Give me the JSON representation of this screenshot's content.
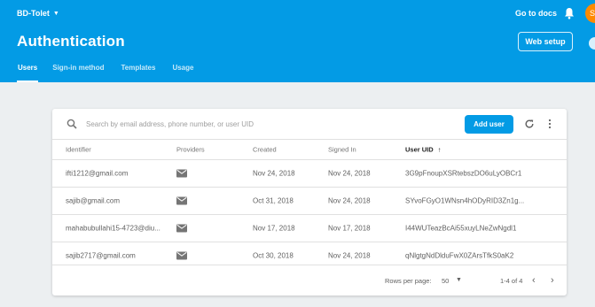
{
  "header": {
    "project_name": "BD-Tolet",
    "go_to_docs": "Go to docs",
    "avatar_initial": "S",
    "title": "Authentication",
    "web_setup": "Web setup",
    "tabs": [
      {
        "label": "Users",
        "active": true
      },
      {
        "label": "Sign-in method",
        "active": false
      },
      {
        "label": "Templates",
        "active": false
      },
      {
        "label": "Usage",
        "active": false
      }
    ]
  },
  "search": {
    "placeholder": "Search by email address, phone number, or user UID"
  },
  "toolbar": {
    "add_user_label": "Add user"
  },
  "table": {
    "headers": {
      "identifier": "Identifier",
      "providers": "Providers",
      "created": "Created",
      "signed_in": "Signed In",
      "user_uid": "User UID",
      "sort_arrow": "↑"
    },
    "rows": [
      {
        "identifier": "ifti1212@gmail.com",
        "provider_icon": "mail-icon",
        "created": "Nov 24, 2018",
        "signed_in": "Nov 24, 2018",
        "uid": "3G9pFnoupXSRtebszDO6uLyOBCr1"
      },
      {
        "identifier": "sajib@gmail.com",
        "provider_icon": "mail-icon",
        "created": "Oct 31, 2018",
        "signed_in": "Nov 24, 2018",
        "uid": "SYvoFGyO1WNsn4hODyRID3Zn1g..."
      },
      {
        "identifier": "mahabubullahi15-4723@diu...",
        "provider_icon": "mail-icon",
        "created": "Nov 17, 2018",
        "signed_in": "Nov 17, 2018",
        "uid": "I44WUTeazBcAi55xuyLNeZwNgdl1"
      },
      {
        "identifier": "sajib2717@gmail.com",
        "provider_icon": "mail-icon",
        "created": "Oct 30, 2018",
        "signed_in": "Nov 24, 2018",
        "uid": "qNlgtgNdDlduFwX0ZArsTfkS0aK2"
      }
    ]
  },
  "pagination": {
    "rows_per_page_label": "Rows per page:",
    "rows_per_page_value": "50",
    "range": "1-4 of 4",
    "prev": "‹",
    "next": "›"
  },
  "colors": {
    "brand": "#039be5",
    "avatar": "#ff8a00",
    "background": "#eceff1"
  }
}
